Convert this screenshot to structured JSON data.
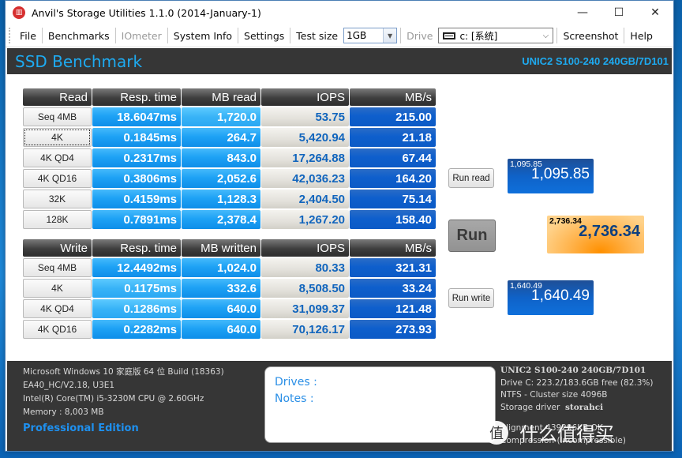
{
  "window": {
    "title": "Anvil's Storage Utilities 1.1.0 (2014-January-1)",
    "controls": {
      "minimize": "—",
      "maximize": "☐",
      "close": "✕"
    }
  },
  "menubar": {
    "items": [
      "File",
      "Benchmarks",
      "IOmeter",
      "System Info",
      "Settings"
    ],
    "disabled": [
      "IOmeter"
    ],
    "test_size_label": "Test size",
    "test_size_value": "1GB",
    "drive_label": "Drive",
    "drive_value": "c: [系统]",
    "screenshot_label": "Screenshot",
    "help_label": "Help"
  },
  "header": {
    "title": "SSD Benchmark",
    "drive_model": "UNIC2 S100-240 240GB/7D101"
  },
  "read_table": {
    "headers": [
      "Read",
      "Resp. time",
      "MB read",
      "IOPS",
      "MB/s"
    ],
    "rows": [
      {
        "test": "Seq 4MB",
        "resp": "18.6047ms",
        "mb": "1,720.0",
        "iops": "53.75",
        "mbs": "215.00"
      },
      {
        "test": "4K",
        "resp": "0.1845ms",
        "mb": "264.7",
        "iops": "5,420.94",
        "mbs": "21.18"
      },
      {
        "test": "4K QD4",
        "resp": "0.2317ms",
        "mb": "843.0",
        "iops": "17,264.88",
        "mbs": "67.44"
      },
      {
        "test": "4K QD16",
        "resp": "0.3806ms",
        "mb": "2,052.6",
        "iops": "42,036.23",
        "mbs": "164.20"
      },
      {
        "test": "32K",
        "resp": "0.4159ms",
        "mb": "1,128.3",
        "iops": "2,404.50",
        "mbs": "75.14"
      },
      {
        "test": "128K",
        "resp": "0.7891ms",
        "mb": "2,378.4",
        "iops": "1,267.20",
        "mbs": "158.40"
      }
    ]
  },
  "write_table": {
    "headers": [
      "Write",
      "Resp. time",
      "MB written",
      "IOPS",
      "MB/s"
    ],
    "rows": [
      {
        "test": "Seq 4MB",
        "resp": "12.4492ms",
        "mb": "1,024.0",
        "iops": "80.33",
        "mbs": "321.31"
      },
      {
        "test": "4K",
        "resp": "0.1175ms",
        "mb": "332.6",
        "iops": "8,508.50",
        "mbs": "33.24"
      },
      {
        "test": "4K QD4",
        "resp": "0.1286ms",
        "mb": "640.0",
        "iops": "31,099.37",
        "mbs": "121.48"
      },
      {
        "test": "4K QD16",
        "resp": "0.2282ms",
        "mb": "640.0",
        "iops": "70,126.17",
        "mbs": "273.93"
      }
    ]
  },
  "actions": {
    "run_read": "Run read",
    "run": "Run",
    "run_write": "Run write"
  },
  "scores": {
    "read": {
      "small": "1,095.85",
      "big": "1,095.85"
    },
    "total": {
      "small": "2,736.34",
      "big": "2,736.34"
    },
    "write": {
      "small": "1,640.49",
      "big": "1,640.49"
    }
  },
  "footer": {
    "sysinfo": [
      "Microsoft Windows 10 家庭版 64 位 Build (18363)",
      "EA40_HC/V2.18, U3E1",
      "Intel(R) Core(TM) i5-3230M CPU @ 2.60GHz",
      "Memory : 8,003 MB"
    ],
    "edition": "Professional Edition",
    "notes": {
      "drives_label": "Drives :",
      "notes_label": "Notes :"
    },
    "drive_info": {
      "model": "UNIC2 S100-240 240GB/7D101",
      "capacity": "Drive C: 223.2/183.6GB free (82.3%)",
      "fs": "NTFS - Cluster size 4096B",
      "driver_label": "Storage driver",
      "driver_value": "storahci",
      "alignment": "Alignment 439296KB OK",
      "compression": "Compression (Incompressible)"
    }
  },
  "watermark": {
    "circle": "值",
    "text": "什么值得买"
  }
}
